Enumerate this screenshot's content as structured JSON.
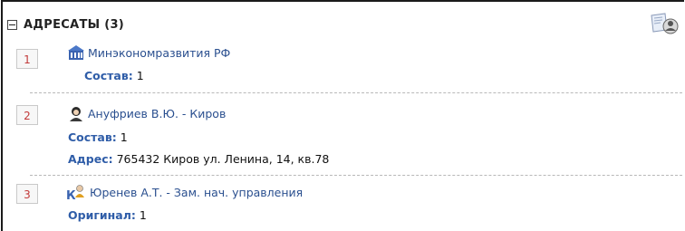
{
  "section": {
    "title": "АДРЕСАТЫ (3)"
  },
  "recipients": [
    {
      "number": "1",
      "icon": "building-icon",
      "name": "Минэкономразвития РФ",
      "composition_label": "Состав:",
      "composition_value": "1"
    },
    {
      "number": "2",
      "icon": "person-icon",
      "name": "Ануфриев В.Ю. - Киров",
      "composition_label": "Состав:",
      "composition_value": "1",
      "address_label": "Адрес:",
      "address_value": "765432 Киров ул. Ленина, 14, кв.78"
    },
    {
      "number": "3",
      "icon": "official-person-icon",
      "name": "Юренев А.Т. - Зам. нач. управления",
      "original_label": "Оригинал:",
      "original_value": "1"
    }
  ],
  "colors": {
    "link": "#2a4f8f",
    "label": "#2f5da8",
    "number": "#c23a3a"
  }
}
